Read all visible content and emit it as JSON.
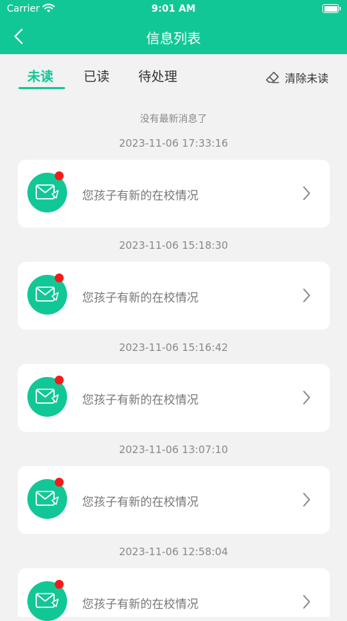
{
  "status": {
    "carrier": "Carrier",
    "time": "9:01 AM"
  },
  "nav": {
    "title": "信息列表"
  },
  "tabs": [
    {
      "label": "未读"
    },
    {
      "label": "已读"
    },
    {
      "label": "待处理"
    }
  ],
  "actions": {
    "clear_unread": "清除未读"
  },
  "list": {
    "no_more": "没有最新消息了",
    "items": [
      {
        "time": "2023-11-06 17:33:16",
        "text": "您孩子有新的在校情况",
        "unread": true
      },
      {
        "time": "2023-11-06 15:18:30",
        "text": "您孩子有新的在校情况",
        "unread": true
      },
      {
        "time": "2023-11-06 15:16:42",
        "text": "您孩子有新的在校情况",
        "unread": true
      },
      {
        "time": "2023-11-06 13:07:10",
        "text": "您孩子有新的在校情况",
        "unread": true
      },
      {
        "time": "2023-11-06 12:58:04",
        "text": "您孩子有新的在校情况",
        "unread": true
      }
    ]
  },
  "colors": {
    "accent": "#12c796",
    "badge": "#f41a1a"
  }
}
